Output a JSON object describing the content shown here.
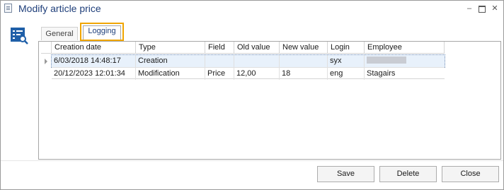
{
  "window": {
    "title": "Modify article price",
    "icon": "document-icon"
  },
  "tabs": [
    {
      "label": "General",
      "active": false
    },
    {
      "label": "Logging",
      "active": true,
      "highlight_color": "#f0a500"
    }
  ],
  "grid": {
    "columns": [
      "Creation date",
      "Type",
      "Field",
      "Old value",
      "New value",
      "Login",
      "Employee"
    ],
    "rows": [
      {
        "creation_date": "6/03/2018 14:48:17",
        "type": "Creation",
        "field": "",
        "old_value": "",
        "new_value": "",
        "login": "syx",
        "employee": "",
        "selected": true
      },
      {
        "creation_date": "20/12/2023 12:01:34",
        "type": "Modification",
        "field": "Price",
        "old_value": "12,00",
        "new_value": "18",
        "login": "eng",
        "employee": "Stagairs",
        "selected": false
      }
    ]
  },
  "buttons": {
    "save": "Save",
    "delete": "Delete",
    "close": "Close"
  },
  "colors": {
    "title": "#1f3f7a",
    "selected_row": "#e8f1fb",
    "tab_highlight": "#f0a500"
  }
}
